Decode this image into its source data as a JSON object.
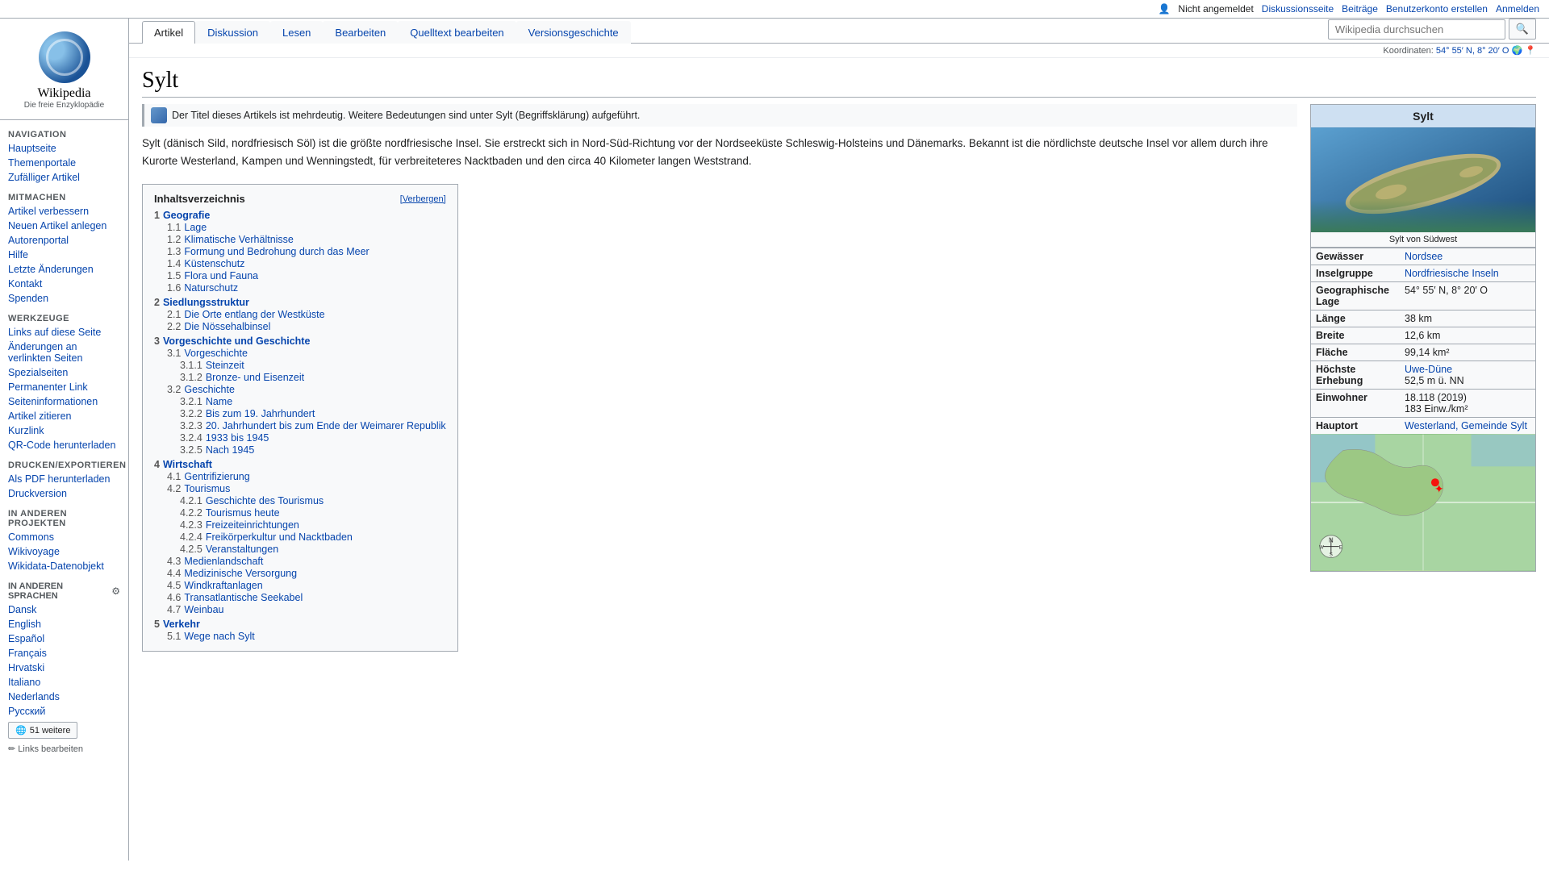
{
  "topbar": {
    "user_icon": "👤",
    "not_logged_in": "Nicht angemeldet",
    "discussion": "Diskussionsseite",
    "contributions": "Beiträge",
    "create_account": "Benutzerkonto erstellen",
    "login": "Anmelden"
  },
  "logo": {
    "wordmark": "Wikipedia",
    "tagline": "Die freie Enzyklopädie"
  },
  "sidebar": {
    "navigation_title": "Navigation",
    "navigation_items": [
      {
        "label": "Hauptseite"
      },
      {
        "label": "Themenportale"
      },
      {
        "label": "Zufälliger Artikel"
      }
    ],
    "contribute_title": "Mitmachen",
    "contribute_items": [
      {
        "label": "Artikel verbessern"
      },
      {
        "label": "Neuen Artikel anlegen"
      },
      {
        "label": "Autorenportal"
      },
      {
        "label": "Hilfe"
      },
      {
        "label": "Letzte Änderungen"
      },
      {
        "label": "Kontakt"
      },
      {
        "label": "Spenden"
      }
    ],
    "tools_title": "Werkzeuge",
    "tools_items": [
      {
        "label": "Links auf diese Seite"
      },
      {
        "label": "Änderungen an verlinkten Seiten"
      },
      {
        "label": "Spezialseiten"
      },
      {
        "label": "Permanenter Link"
      },
      {
        "label": "Seiteninformationen"
      },
      {
        "label": "Artikel zitieren"
      },
      {
        "label": "Kurzlink"
      },
      {
        "label": "QR-Code herunterladen"
      }
    ],
    "print_title": "Drucken/exportieren",
    "print_items": [
      {
        "label": "Als PDF herunterladen"
      },
      {
        "label": "Druckversion"
      }
    ],
    "other_projects_title": "In anderen Projekten",
    "other_projects_items": [
      {
        "label": "Commons"
      },
      {
        "label": "Wikivoyage"
      },
      {
        "label": "Wikidata-Datenobjekt"
      }
    ],
    "other_languages_title": "In anderen Sprachen",
    "languages": [
      {
        "label": "Dansk"
      },
      {
        "label": "English"
      },
      {
        "label": "Español"
      },
      {
        "label": "Français"
      },
      {
        "label": "Hrvatski"
      },
      {
        "label": "Italiano"
      },
      {
        "label": "Nederlands"
      },
      {
        "label": "Русский"
      }
    ],
    "more_languages_button": "51 weitere",
    "links_edit": "Links bearbeiten"
  },
  "tabs": {
    "article": "Artikel",
    "discussion": "Diskussion",
    "read": "Lesen",
    "edit": "Bearbeiten",
    "source_edit": "Quelltext bearbeiten",
    "history": "Versionsgeschichte"
  },
  "search": {
    "placeholder": "Wikipedia durchsuchen",
    "button_label": "🔍"
  },
  "coords": {
    "label": "Koordinaten:",
    "value": "54° 55′ N, 8° 20′ O",
    "globe_icon": "🌍",
    "osm_icon": "📍"
  },
  "article": {
    "title": "Sylt",
    "hatnote": "Der Titel dieses Artikels ist mehrdeutig. Weitere Bedeutungen sind unter Sylt (Begriffsklärung) aufgeführt.",
    "lead_text": "Sylt (dänisch Sild, nordfriesisch Söl) ist die größte nordfriesische Insel. Sie erstreckt sich in Nord-Süd-Richtung vor der Nordseeküste Schleswig-Holsteins und Dänemarks. Bekannt ist die nördlichste deutsche Insel vor allem durch ihre Kurorte Westerland, Kampen und Wenningstedt, für verbreiteteres Nacktbaden und den circa 40 Kilometer langen Weststrand.",
    "toc": {
      "title": "Inhaltsverzeichnis",
      "hide_label": "Verbergen",
      "items": [
        {
          "num": "1",
          "label": "Geografie",
          "level": 1
        },
        {
          "num": "1.1",
          "label": "Lage",
          "level": 2
        },
        {
          "num": "1.2",
          "label": "Klimatische Verhältnisse",
          "level": 2
        },
        {
          "num": "1.3",
          "label": "Formung und Bedrohung durch das Meer",
          "level": 2
        },
        {
          "num": "1.4",
          "label": "Küstenschutz",
          "level": 2
        },
        {
          "num": "1.5",
          "label": "Flora und Fauna",
          "level": 2
        },
        {
          "num": "1.6",
          "label": "Naturschutz",
          "level": 2
        },
        {
          "num": "2",
          "label": "Siedlungsstruktur",
          "level": 1
        },
        {
          "num": "2.1",
          "label": "Die Orte entlang der Westküste",
          "level": 2
        },
        {
          "num": "2.2",
          "label": "Die Nössehalbinsel",
          "level": 2
        },
        {
          "num": "3",
          "label": "Vorgeschichte und Geschichte",
          "level": 1
        },
        {
          "num": "3.1",
          "label": "Vorgeschichte",
          "level": 2
        },
        {
          "num": "3.1.1",
          "label": "Steinzeit",
          "level": 3
        },
        {
          "num": "3.1.2",
          "label": "Bronze- und Eisenzeit",
          "level": 3
        },
        {
          "num": "3.2",
          "label": "Geschichte",
          "level": 2
        },
        {
          "num": "3.2.1",
          "label": "Name",
          "level": 3
        },
        {
          "num": "3.2.2",
          "label": "Bis zum 19. Jahrhundert",
          "level": 3
        },
        {
          "num": "3.2.3",
          "label": "20. Jahrhundert bis zum Ende der Weimarer Republik",
          "level": 3
        },
        {
          "num": "3.2.4",
          "label": "1933 bis 1945",
          "level": 3
        },
        {
          "num": "3.2.5",
          "label": "Nach 1945",
          "level": 3
        },
        {
          "num": "4",
          "label": "Wirtschaft",
          "level": 1
        },
        {
          "num": "4.1",
          "label": "Gentrifizierung",
          "level": 2
        },
        {
          "num": "4.2",
          "label": "Tourismus",
          "level": 2
        },
        {
          "num": "4.2.1",
          "label": "Geschichte des Tourismus",
          "level": 3
        },
        {
          "num": "4.2.2",
          "label": "Tourismus heute",
          "level": 3
        },
        {
          "num": "4.2.3",
          "label": "Freizeiteinrichtungen",
          "level": 3
        },
        {
          "num": "4.2.4",
          "label": "Freikörperkultur und Nacktbaden",
          "level": 3
        },
        {
          "num": "4.2.5",
          "label": "Veranstaltungen",
          "level": 3
        },
        {
          "num": "4.3",
          "label": "Medienlandschaft",
          "level": 2
        },
        {
          "num": "4.4",
          "label": "Medizinische Versorgung",
          "level": 2
        },
        {
          "num": "4.5",
          "label": "Windkraftanlagen",
          "level": 2
        },
        {
          "num": "4.6",
          "label": "Transatlantische Seekabel",
          "level": 2
        },
        {
          "num": "4.7",
          "label": "Weinbau",
          "level": 2
        },
        {
          "num": "5",
          "label": "Verkehr",
          "level": 1
        },
        {
          "num": "5.1",
          "label": "Wege nach Sylt",
          "level": 2
        }
      ]
    }
  },
  "infobox": {
    "title": "Sylt",
    "image_caption": "Sylt von Südwest",
    "rows": [
      {
        "label": "Gewässer",
        "value": "Nordsee",
        "linked": true
      },
      {
        "label": "Inselgruppe",
        "value": "Nordfriesische Inseln",
        "linked": true
      },
      {
        "label": "Geographische Lage",
        "value": "54° 55′ N, 8° 20′ O",
        "linked": false
      },
      {
        "label": "Länge",
        "value": "38 km",
        "linked": false
      },
      {
        "label": "Breite",
        "value": "12,6 km",
        "linked": false
      },
      {
        "label": "Fläche",
        "value": "99,14 km²",
        "linked": false
      },
      {
        "label": "Höchste Erhebung",
        "value": "Uwe-Düne\n52,5 m ü. NN",
        "linked": true
      },
      {
        "label": "Einwohner",
        "value": "18.118 (2019)\n183 Einw./km²",
        "linked": false
      },
      {
        "label": "Hauptort",
        "value": "Westerland, Gemeinde Sylt",
        "linked": true
      }
    ]
  }
}
